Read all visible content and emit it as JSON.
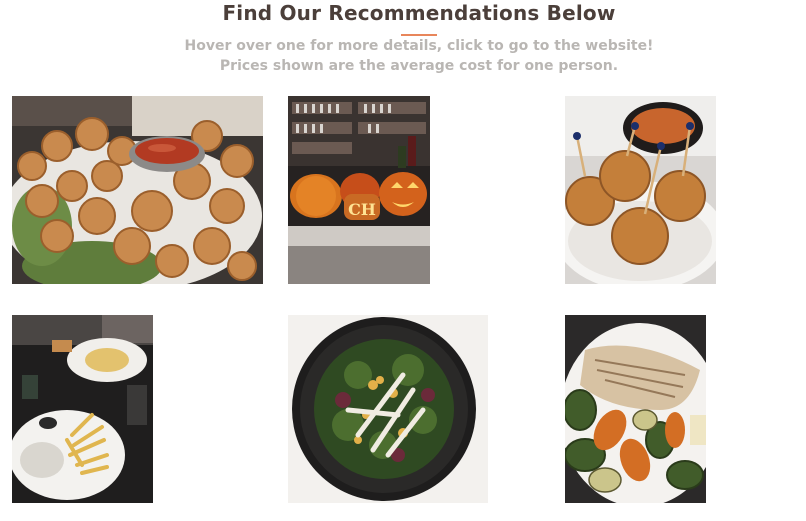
{
  "header": {
    "title": "Find Our Recommendations Below",
    "subtitle_line1": "Hover over one for more details, click to go to the website!",
    "subtitle_line2": "Prices shown are the average cost for one person.",
    "accent_color": "#e8865b"
  },
  "cards": [
    {
      "icon": "fried-cauliflower-photo"
    },
    {
      "icon": "halloween-pumpkins-photo",
      "sign_text": "CH"
    },
    {
      "icon": "croquettes-on-skewers-photo"
    },
    {
      "icon": "fries-and-dip-table-photo"
    },
    {
      "icon": "salad-bowl-photo"
    },
    {
      "icon": "fish-with-grilled-vegetables-photo"
    }
  ]
}
